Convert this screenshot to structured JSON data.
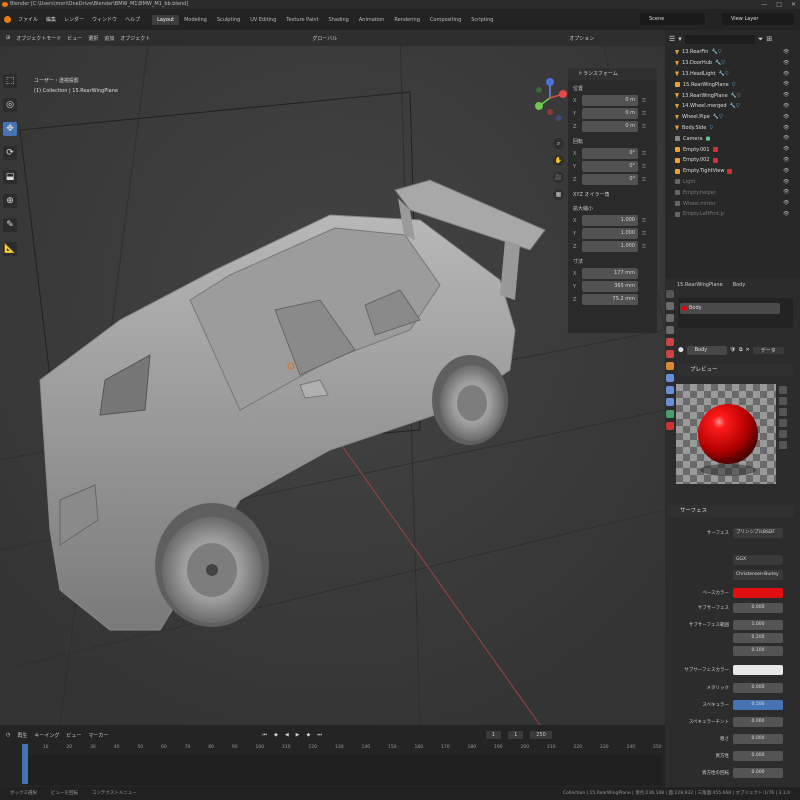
{
  "titlebar": {
    "title": "Blender [C:\\Users\\mori\\OneDrive\\Blender\\BMW_M1\\BMW_M1_bb.blend]",
    "controls": [
      "—",
      "□",
      "✕"
    ]
  },
  "menu": {
    "items": [
      "ファイル",
      "編集",
      "レンダー",
      "ウィンドウ",
      "ヘルプ"
    ],
    "workspaces": [
      "Layout",
      "Modeling",
      "Sculpting",
      "UV Editing",
      "Texture Paint",
      "Shading",
      "Animation",
      "Rendering",
      "Compositing",
      "Scripting"
    ],
    "active_workspace": "Layout",
    "scene": "Scene",
    "view_layer": "View Layer"
  },
  "viewport": {
    "toolbar": [
      "オブジェクトモード",
      "ビュー",
      "選択",
      "追加",
      "オブジェクト"
    ],
    "toolbar2": [
      "グローバル",
      "オプション"
    ],
    "transform_orient": "グローバル",
    "info_line1": "ユーザー・透視投影",
    "info_line2": "(1) Collection | 15.RearWingPlane",
    "tools": [
      "select-icon",
      "cursor-icon",
      "move-icon",
      "rotate-icon",
      "scale-icon",
      "transform-icon",
      "annotate-icon",
      "measure-icon"
    ],
    "nav": [
      "✋",
      "🎥",
      "▦"
    ]
  },
  "npanel": {
    "header": "トランスフォーム",
    "location_label": "位置",
    "location": [
      {
        "axis": "X",
        "value": "0 m"
      },
      {
        "axis": "Y",
        "value": "0 m"
      },
      {
        "axis": "Z",
        "value": "0 m"
      }
    ],
    "rotation_label": "回転",
    "rotation": [
      {
        "axis": "X",
        "value": "0°"
      },
      {
        "axis": "Y",
        "value": "0°"
      },
      {
        "axis": "Z",
        "value": "0°"
      }
    ],
    "mode": "XYZ オイラー角",
    "scale_label": "拡大縮小",
    "scale": [
      {
        "axis": "X",
        "value": "1.000"
      },
      {
        "axis": "Y",
        "value": "1.000"
      },
      {
        "axis": "Z",
        "value": "1.000"
      }
    ],
    "dims_label": "寸法",
    "dims": [
      {
        "axis": "X",
        "value": "177 mm"
      },
      {
        "axis": "Y",
        "value": "365 mm"
      },
      {
        "axis": "Z",
        "value": "75.2 mm"
      }
    ]
  },
  "timeline": {
    "menus": [
      "再生",
      "キーイング",
      "ビュー",
      "マーカー"
    ],
    "frame": "1",
    "start": "1",
    "end": "250",
    "ticks": [
      "0",
      "10",
      "20",
      "30",
      "40",
      "50",
      "60",
      "70",
      "80",
      "90",
      "100",
      "110",
      "120",
      "130",
      "140",
      "150",
      "160",
      "170",
      "180",
      "190",
      "200",
      "210",
      "220",
      "230",
      "240",
      "250"
    ]
  },
  "status": {
    "left": [
      "ボックス選択",
      "ビューを回転",
      "コンテクストメニュー"
    ],
    "right": "Collection | 15.RearWingPlane | 頂点:236,148 | 面:228,932 | 三角面:455,668 | オブジェクト:1/76 | 3.1.0"
  },
  "outliner": {
    "search_placeholder": "",
    "items": [
      {
        "label": "13.RearFin"
      },
      {
        "label": "13.DoorHub"
      },
      {
        "label": "13.HeadLight"
      },
      {
        "label": "15.RearWingPlane"
      },
      {
        "label": "13.RearWingPlane"
      },
      {
        "label": "14.Wheel.merged"
      },
      {
        "label": "Wheel.Pipe"
      },
      {
        "label": "Body.Side"
      },
      {
        "label": "Camera"
      },
      {
        "label": "Empty.001"
      },
      {
        "label": "Empty.002"
      },
      {
        "label": "Empty.TightView"
      },
      {
        "label": "Light"
      },
      {
        "label": "Empty.helper"
      },
      {
        "label": "Wheel.mirror"
      },
      {
        "label": "Empty.LeftFrnt.p"
      }
    ]
  },
  "properties": {
    "breadcrumb_obj": "15.RearWingPlane",
    "breadcrumb_mat": "Body",
    "slot": "Body",
    "material": "Body",
    "link": "データ",
    "preview_header": "プレビュー",
    "surface_header": "サーフェス",
    "surface_label": "サーフェス",
    "surface_value": "プリンシプルBSDF",
    "distribution": "GGX",
    "subsurface_method": "Christensen-Burley",
    "rows": [
      {
        "label": "ベースカラー",
        "value": "",
        "style": "red"
      },
      {
        "label": "サブサーフェス",
        "value": "0.000",
        "style": ""
      },
      {
        "label": "サブサーフェス範囲",
        "value": "1.000",
        "style": ""
      },
      {
        "label": "",
        "value": "0.200",
        "style": ""
      },
      {
        "label": "",
        "value": "0.100",
        "style": ""
      },
      {
        "label": "サブサーフェスカラー",
        "value": "",
        "style": "white"
      },
      {
        "label": "メタリック",
        "value": "0.000",
        "style": ""
      },
      {
        "label": "スペキュラー",
        "value": "0.500",
        "style": "blue"
      },
      {
        "label": "スペキュラーチント",
        "value": "0.000",
        "style": ""
      },
      {
        "label": "粗さ",
        "value": "0.000",
        "style": ""
      },
      {
        "label": "異方性",
        "value": "0.000",
        "style": ""
      },
      {
        "label": "異方性の回転",
        "value": "0.000",
        "style": ""
      }
    ],
    "colors": {
      "base": "#e01010",
      "accent": "#4772b3"
    }
  }
}
